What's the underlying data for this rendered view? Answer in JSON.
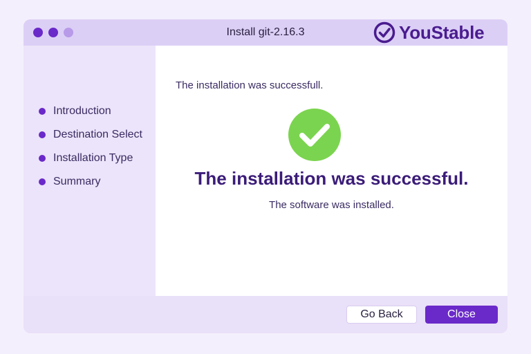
{
  "window": {
    "title": "Install git-2.16.3",
    "brand": "YouStable"
  },
  "sidebar": {
    "items": [
      {
        "label": "Introduction"
      },
      {
        "label": "Destination Select"
      },
      {
        "label": "Installation Type"
      },
      {
        "label": "Summary"
      }
    ]
  },
  "main": {
    "status_text": "The installation was successfull.",
    "headline": "The installation was successful.",
    "subtext": "The software was installed.",
    "icon": "check-circle-icon"
  },
  "footer": {
    "back_label": "Go Back",
    "close_label": "Close"
  },
  "colors": {
    "accent": "#6a29c9",
    "success": "#7bd44f",
    "headline": "#3b1c78"
  }
}
